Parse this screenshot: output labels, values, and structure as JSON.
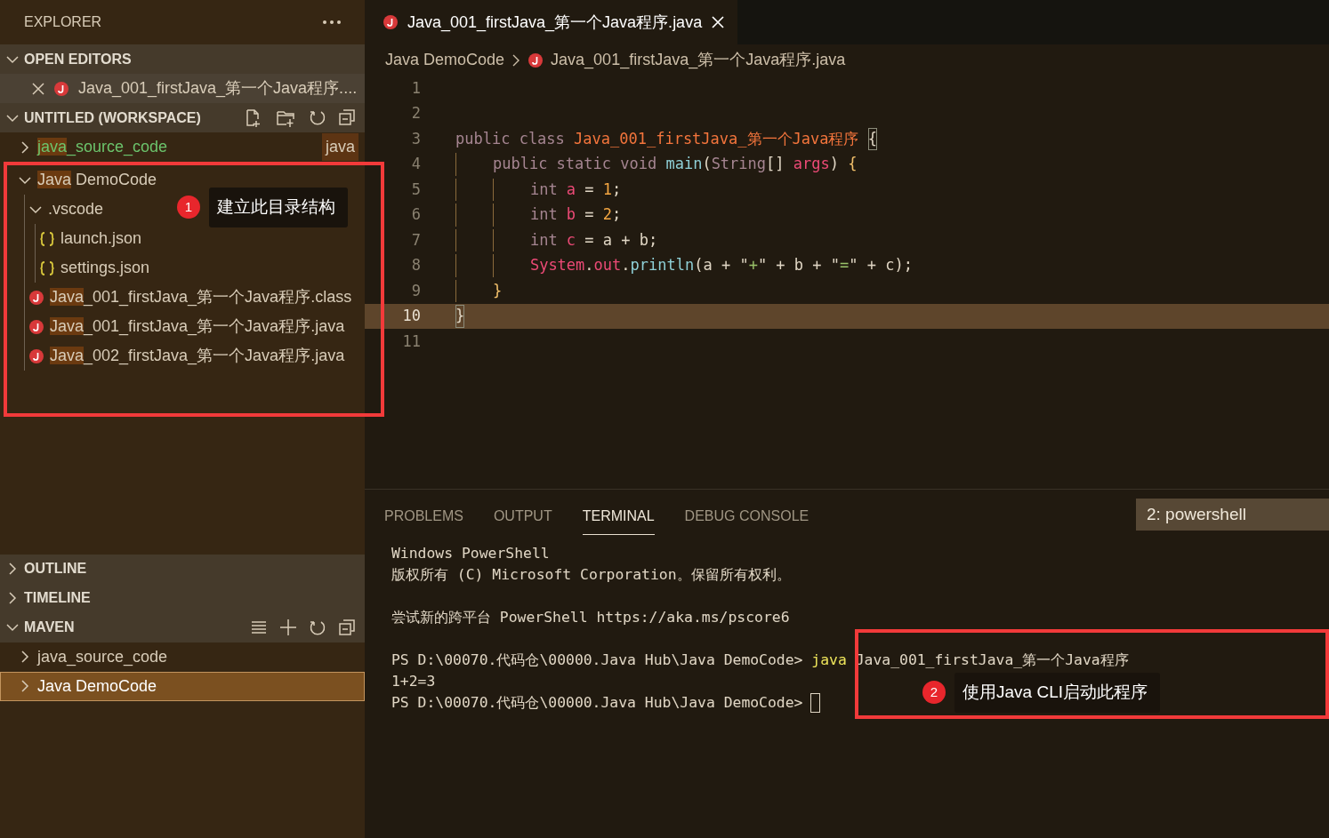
{
  "sidebar": {
    "title": "EXPLORER",
    "sections": [
      {
        "title": "OPEN EDITORS",
        "expanded": true,
        "kind": "editors",
        "items": [
          {
            "label": "Java_001_firstJava_第一个Java程序....",
            "kind": "java-file"
          }
        ]
      },
      {
        "title": "UNTITLED (WORKSPACE)",
        "expanded": true,
        "kind": "workspace",
        "items": [
          {
            "parts": [
              {
                "text": "java",
                "match": true
              },
              {
                "text": "_source_code",
                "match": false
              }
            ],
            "kind": "folder",
            "expanded": false,
            "decorated": true,
            "badge": "java",
            "selected": false
          },
          {
            "parts": [
              {
                "text": "Java",
                "match": true
              },
              {
                "text": " DemoCode",
                "match": false
              }
            ],
            "kind": "folder",
            "expanded": true,
            "decorated": false,
            "selected": false,
            "children": [
              {
                "parts": [
                  {
                    "text": ".vscode",
                    "match": false
                  }
                ],
                "kind": "folder",
                "expanded": true,
                "decorated": false,
                "selected": false,
                "children": [
                  {
                    "parts": [
                      {
                        "text": "launch.json",
                        "match": false
                      }
                    ],
                    "kind": "json-file",
                    "decorated": false,
                    "selected": false
                  },
                  {
                    "parts": [
                      {
                        "text": "settings.json",
                        "match": false
                      }
                    ],
                    "kind": "json-file",
                    "decorated": false,
                    "selected": false
                  }
                ]
              },
              {
                "parts": [
                  {
                    "text": "Java",
                    "match": true
                  },
                  {
                    "text": "_001_firstJava_第一个Java程序.class",
                    "match": false
                  }
                ],
                "kind": "java-file",
                "decorated": false,
                "selected": false
              },
              {
                "parts": [
                  {
                    "text": "Java",
                    "match": true
                  },
                  {
                    "text": "_001_firstJava_第一个Java程序.java",
                    "match": false
                  }
                ],
                "kind": "java-file",
                "decorated": false,
                "selected": false
              },
              {
                "parts": [
                  {
                    "text": "Java",
                    "match": true
                  },
                  {
                    "text": "_002_firstJava_第一个Java程序.java",
                    "match": false
                  }
                ],
                "kind": "java-file",
                "decorated": false,
                "selected": false
              }
            ]
          }
        ]
      },
      {
        "title": "OUTLINE",
        "expanded": false,
        "kind": "plain"
      },
      {
        "title": "TIMELINE",
        "expanded": false,
        "kind": "plain"
      },
      {
        "title": "MAVEN",
        "expanded": true,
        "kind": "maven",
        "items": [
          {
            "parts": [
              {
                "text": "java_source_code",
                "match": false
              }
            ],
            "kind": "folder",
            "expanded": false,
            "decorated": false,
            "selected": false
          },
          {
            "parts": [
              {
                "text": "Java DemoCode",
                "match": false
              }
            ],
            "kind": "folder",
            "expanded": false,
            "decorated": false,
            "selected": true
          }
        ]
      }
    ]
  },
  "editor": {
    "tabs": [
      {
        "label": "Java_001_firstJava_第一个Java程序.java",
        "selected": true
      }
    ],
    "breadcrumb": [
      "Java DemoCode",
      "Java_001_firstJava_第一个Java程序.java"
    ],
    "lines": [
      {
        "number": "1",
        "selected": false
      },
      {
        "number": "2",
        "selected": false
      },
      {
        "number": "3",
        "selected": false,
        "tokens": [
          {
            "text": "public class ",
            "kind": "keyword"
          },
          {
            "text": "Java_001_firstJava_第一个Java程序 ",
            "kind": "class"
          },
          {
            "text": "{",
            "kind": "bracket-match"
          }
        ]
      },
      {
        "number": "4",
        "selected": false,
        "tokens": [
          {
            "text": "    public static void ",
            "kind": "keyword"
          },
          {
            "text": "main",
            "kind": "function"
          },
          {
            "text": "(",
            "kind": "plain"
          },
          {
            "text": "String",
            "kind": "keyword"
          },
          {
            "text": "[] ",
            "kind": "plain"
          },
          {
            "text": "args",
            "kind": "variable"
          },
          {
            "text": ") ",
            "kind": "plain"
          },
          {
            "text": "{",
            "kind": "brace"
          }
        ]
      },
      {
        "number": "5",
        "selected": false,
        "tokens": [
          {
            "text": "        int ",
            "kind": "keyword"
          },
          {
            "text": "a",
            "kind": "variable"
          },
          {
            "text": " = ",
            "kind": "plain"
          },
          {
            "text": "1",
            "kind": "number"
          },
          {
            "text": ";",
            "kind": "plain"
          }
        ]
      },
      {
        "number": "6",
        "selected": false,
        "tokens": [
          {
            "text": "        int ",
            "kind": "keyword"
          },
          {
            "text": "b",
            "kind": "variable"
          },
          {
            "text": " = ",
            "kind": "plain"
          },
          {
            "text": "2",
            "kind": "number"
          },
          {
            "text": ";",
            "kind": "plain"
          }
        ]
      },
      {
        "number": "7",
        "selected": false,
        "tokens": [
          {
            "text": "        int ",
            "kind": "keyword"
          },
          {
            "text": "c",
            "kind": "variable"
          },
          {
            "text": " = a + b;",
            "kind": "plain"
          }
        ]
      },
      {
        "number": "8",
        "selected": false,
        "tokens": [
          {
            "text": "        System",
            "kind": "variable"
          },
          {
            "text": ".",
            "kind": "plain"
          },
          {
            "text": "out",
            "kind": "variable"
          },
          {
            "text": ".",
            "kind": "plain"
          },
          {
            "text": "println",
            "kind": "function"
          },
          {
            "text": "(a + \"",
            "kind": "plain"
          },
          {
            "text": "+",
            "kind": "string"
          },
          {
            "text": "\" + b + \"",
            "kind": "plain"
          },
          {
            "text": "=",
            "kind": "string"
          },
          {
            "text": "\" + c);",
            "kind": "plain"
          }
        ]
      },
      {
        "number": "9",
        "selected": false,
        "tokens": [
          {
            "text": "    }",
            "kind": "brace"
          }
        ]
      },
      {
        "number": "10",
        "selected": true,
        "tokens": [
          {
            "text": "}",
            "kind": "bracket-match"
          }
        ]
      },
      {
        "number": "11",
        "selected": false
      }
    ]
  },
  "panel": {
    "tabs": [
      {
        "label": "PROBLEMS",
        "selected": false
      },
      {
        "label": "OUTPUT",
        "selected": false
      },
      {
        "label": "TERMINAL",
        "selected": true
      },
      {
        "label": "DEBUG CONSOLE",
        "selected": false
      }
    ],
    "terminal_picker": "2: powershell",
    "lines": [
      {
        "spaced": false,
        "cursor": false,
        "segments": [
          {
            "text": "Windows PowerShell",
            "kind": "plain"
          }
        ]
      },
      {
        "spaced": false,
        "cursor": false,
        "segments": [
          {
            "text": "版权所有 (C) Microsoft Corporation。保留所有权利。",
            "kind": "plain"
          }
        ]
      },
      {
        "spaced": true,
        "cursor": false,
        "segments": [
          {
            "text": "尝试新的跨平台 PowerShell https://aka.ms/pscore6",
            "kind": "plain"
          }
        ]
      },
      {
        "spaced": true,
        "cursor": false,
        "segments": [
          {
            "text": "PS D:\\00070.代码仓\\00000.Java Hub\\Java DemoCode>",
            "kind": "plain"
          },
          {
            "text": " java",
            "kind": "command"
          },
          {
            "text": " Java_001_firstJava_第一个Java程序",
            "kind": "plain"
          }
        ]
      },
      {
        "spaced": false,
        "cursor": false,
        "segments": [
          {
            "text": "1+2=3",
            "kind": "plain"
          }
        ]
      },
      {
        "spaced": false,
        "cursor": true,
        "segments": [
          {
            "text": "PS D:\\00070.代码仓\\00000.Java Hub\\Java DemoCode>",
            "kind": "plain"
          }
        ]
      }
    ]
  },
  "annotations": [
    {
      "number": "1",
      "text": "建立此目录结构"
    },
    {
      "number": "2",
      "text": "使用Java CLI启动此程序"
    }
  ]
}
